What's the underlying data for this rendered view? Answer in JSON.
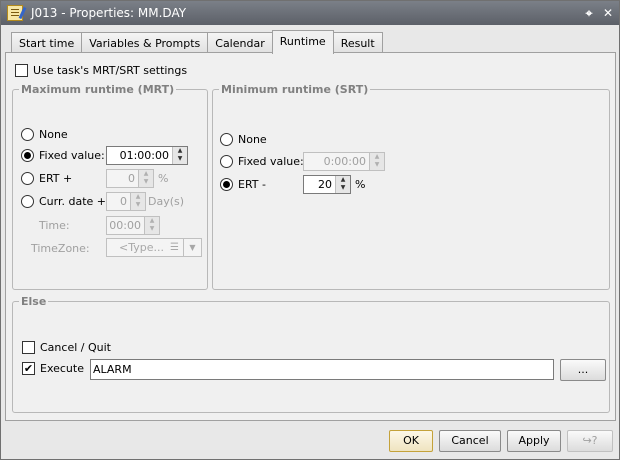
{
  "window": {
    "title": "J013 - Properties: MM.DAY",
    "pin_glyph": "⌖",
    "close_glyph": "✕"
  },
  "tabs": [
    {
      "label": "Start time"
    },
    {
      "label": "Variables & Prompts"
    },
    {
      "label": "Calendar"
    },
    {
      "label": "Runtime",
      "active": true
    },
    {
      "label": "Result"
    }
  ],
  "use_task_settings": {
    "label": "Use task's MRT/SRT settings",
    "checked": false
  },
  "mrt": {
    "legend": "Maximum runtime (MRT)",
    "none_label": "None",
    "fixed_label": "Fixed value:",
    "fixed_value": "01:00:00",
    "ert_label": "ERT +",
    "ert_value": "0",
    "ert_unit": "%",
    "curr_label": "Curr. date +",
    "curr_value": "0",
    "curr_unit": "Day(s)",
    "time_label": "Time:",
    "time_value": "00:00",
    "tz_label": "TimeZone:",
    "tz_placeholder": "<Type...",
    "selected": "fixed"
  },
  "srt": {
    "legend": "Minimum runtime (SRT)",
    "none_label": "None",
    "fixed_label": "Fixed value:",
    "fixed_value": "0:00:00",
    "ert_label": "ERT -",
    "ert_value": "20",
    "ert_unit": "%",
    "selected": "ert"
  },
  "else_group": {
    "legend": "Else",
    "cancel_label": "Cancel / Quit",
    "cancel_checked": false,
    "execute_label": "Execute",
    "execute_checked": true,
    "execute_value": "ALARM",
    "browse_label": "..."
  },
  "footer": {
    "ok_label": "OK",
    "cancel_label": "Cancel",
    "apply_label": "Apply",
    "help_glyph": "↪?"
  },
  "icons": {
    "check": "✔",
    "up": "▲",
    "down": "▼",
    "list": "☰"
  },
  "colors": {
    "titlebar": "#6a6e75",
    "default_button_border": "#c4a23a"
  }
}
